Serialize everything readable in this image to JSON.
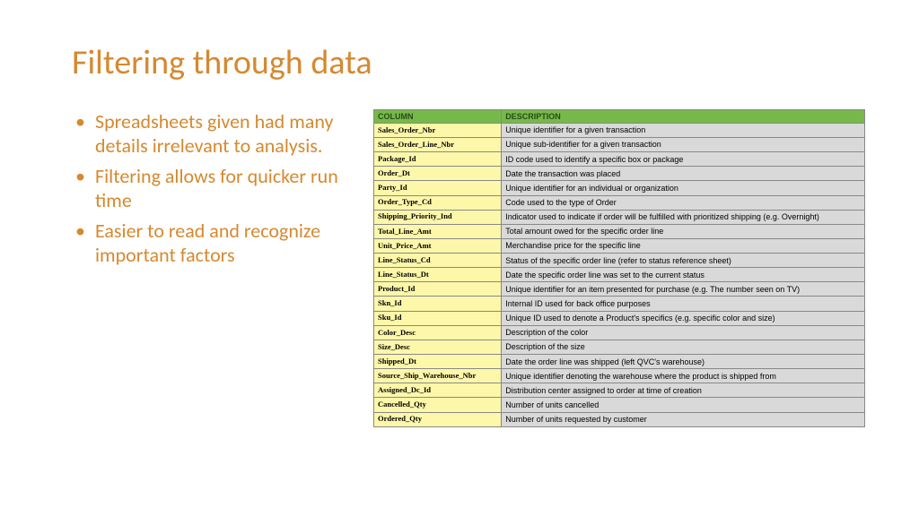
{
  "title": "Filtering through data",
  "bullets": [
    "Spreadsheets given had many details irrelevant to analysis.",
    "Filtering allows for quicker run time",
    "Easier to read and recognize important factors"
  ],
  "table": {
    "headers": {
      "col": "COLUMN",
      "desc": "DESCRIPTION"
    },
    "rows": [
      {
        "col": "Sales_Order_Nbr",
        "desc": "Unique identifier for a given transaction"
      },
      {
        "col": "Sales_Order_Line_Nbr",
        "desc": "Unique sub-identifier for a given transaction"
      },
      {
        "col": "Package_Id",
        "desc": "ID code used to identify a specific box or package"
      },
      {
        "col": "Order_Dt",
        "desc": "Date the transaction was placed"
      },
      {
        "col": "Party_Id",
        "desc": "Unique identifier for an individual or organization"
      },
      {
        "col": "Order_Type_Cd",
        "desc": "Code used to the type of Order"
      },
      {
        "col": "Shipping_Priority_Ind",
        "desc": "Indicator used to indicate if order will be fulfilled with prioritized shipping (e.g. Overnight)"
      },
      {
        "col": "Total_Line_Amt",
        "desc": "Total amount owed for the specific order line"
      },
      {
        "col": "Unit_Price_Amt",
        "desc": "Merchandise price for the specific line"
      },
      {
        "col": "Line_Status_Cd",
        "desc": "Status of the specific order line (refer to status reference sheet)"
      },
      {
        "col": "Line_Status_Dt",
        "desc": "Date the specific order line was set to the current status"
      },
      {
        "col": "Product_Id",
        "desc": "Unique identifier for an item presented for purchase (e.g. The number seen on TV)"
      },
      {
        "col": "Skn_Id",
        "desc": "Internal ID used for back office purposes"
      },
      {
        "col": "Sku_Id",
        "desc": "Unique ID used to denote a Product's specifics (e.g. specific color and size)"
      },
      {
        "col": "Color_Desc",
        "desc": "Description of the color"
      },
      {
        "col": "Size_Desc",
        "desc": "Description of the size"
      },
      {
        "col": "Shipped_Dt",
        "desc": "Date the order line was shipped (left QVC's warehouse)"
      },
      {
        "col": "Source_Ship_Warehouse_Nbr",
        "desc": "Unique identifier denoting the warehouse where the product is shipped from"
      },
      {
        "col": "Assigned_Dc_Id",
        "desc": "Distribution center assigned to order at time of creation"
      },
      {
        "col": "Cancelled_Qty",
        "desc": "Number of units cancelled"
      },
      {
        "col": "Ordered_Qty",
        "desc": "Number of units requested by customer"
      }
    ]
  }
}
